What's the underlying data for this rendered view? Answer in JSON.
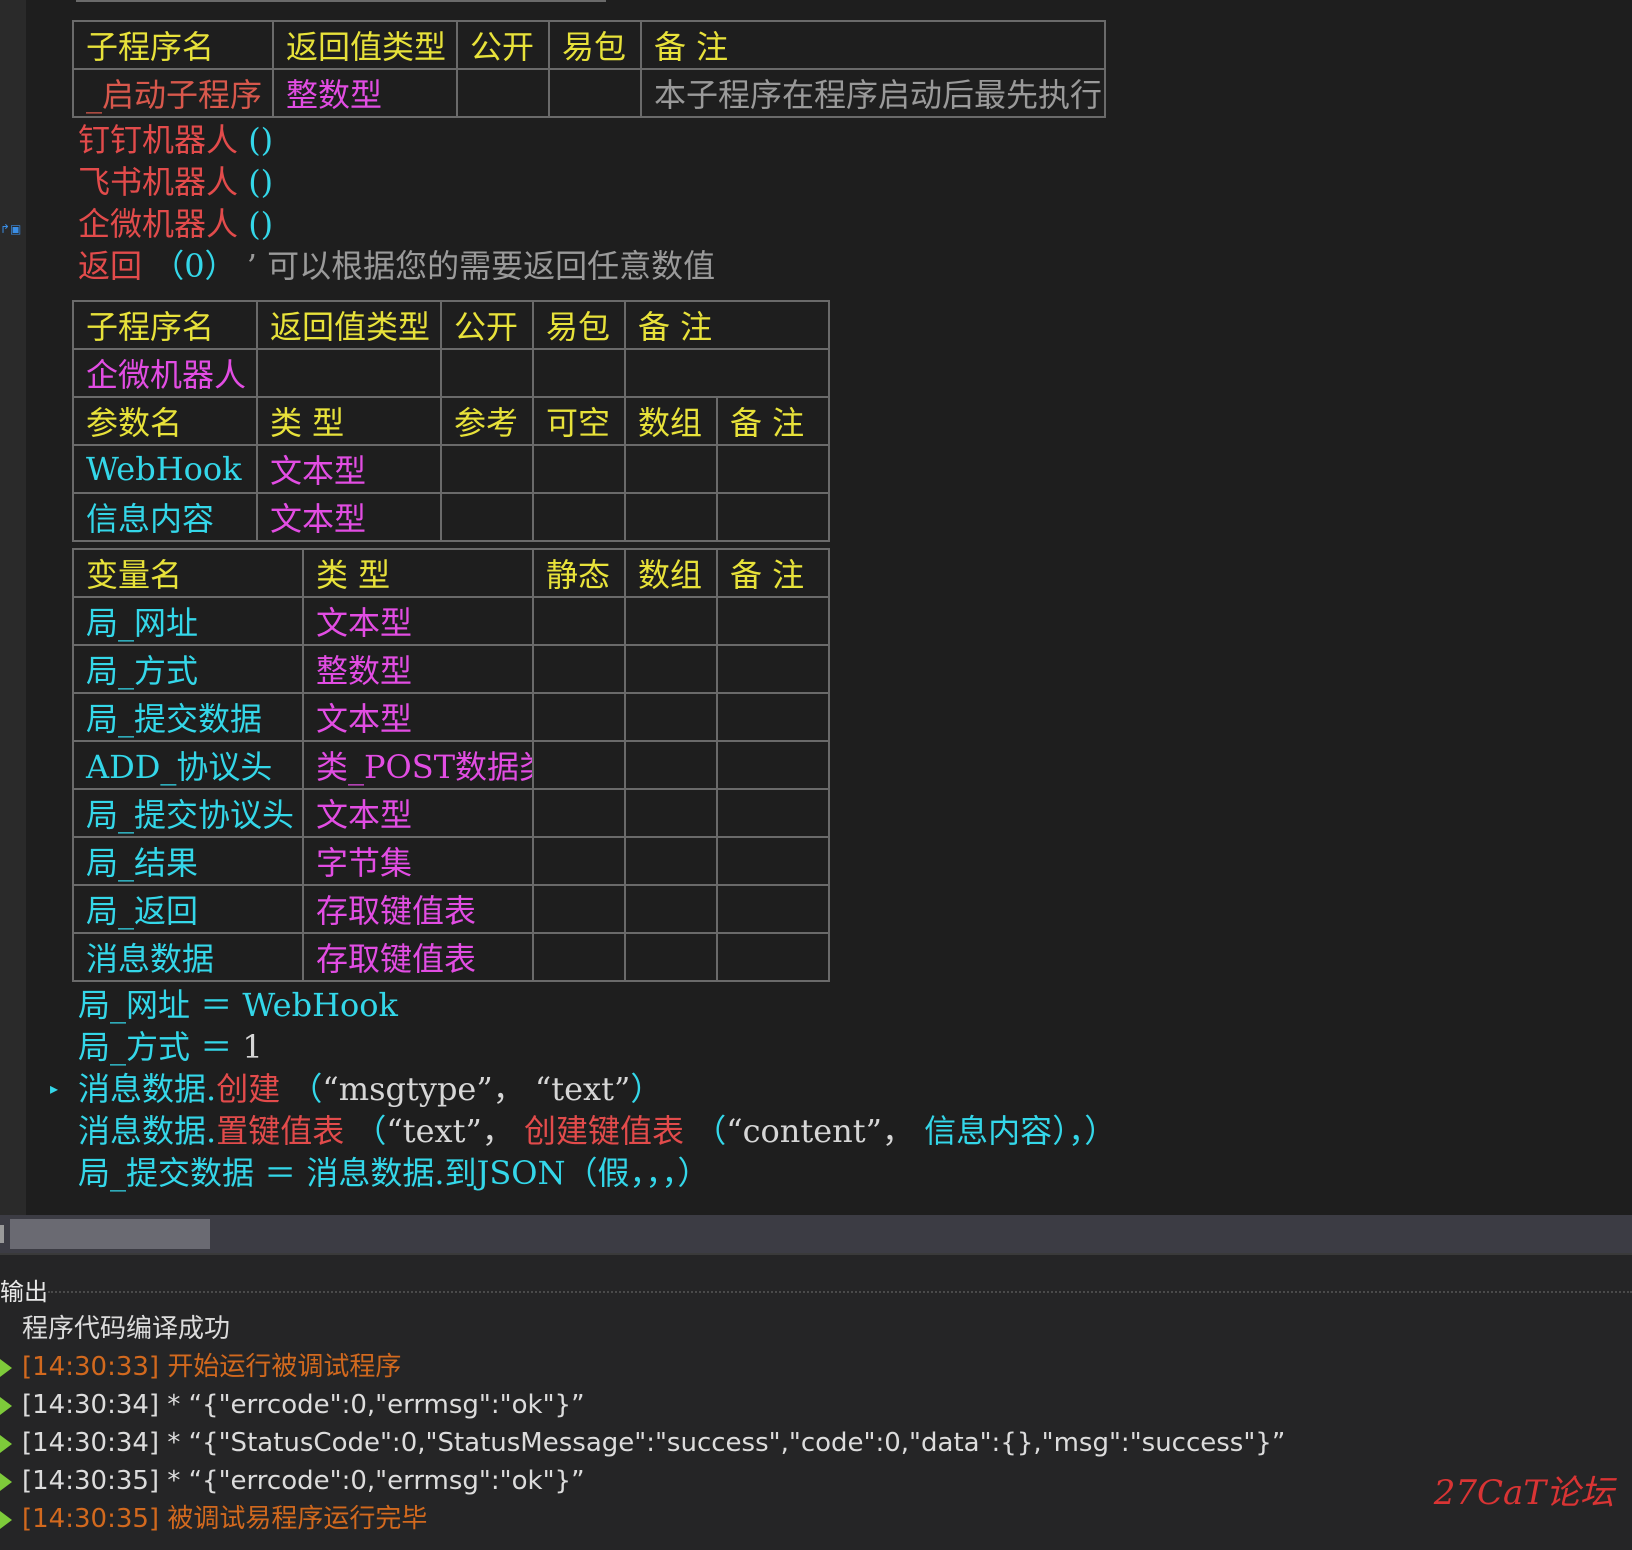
{
  "gutter": {
    "marker": "↱▣"
  },
  "table1": {
    "headers": [
      "子程序名",
      "返回值类型",
      "公开",
      "易包",
      "备 注"
    ],
    "row": {
      "name": "_启动子程序",
      "return_type": "整数型",
      "public": "",
      "package": "",
      "note": "本子程序在程序启动后最先执行"
    }
  },
  "code1": {
    "lines": [
      {
        "call": "钉钉机器人",
        "args": "()"
      },
      {
        "call": "飞书机器人",
        "args": "()"
      },
      {
        "call": "企微机器人",
        "args": "()"
      }
    ],
    "return_kw": "返回",
    "return_args": "（0）",
    "comment_mark": "’",
    "comment": "可以根据您的需要返回任意数值"
  },
  "table2": {
    "headers": [
      "子程序名",
      "返回值类型",
      "公开",
      "易包",
      "备 注"
    ],
    "name": "企微机器人",
    "param_headers": [
      "参数名",
      "类 型",
      "参考",
      "可空",
      "数组",
      "备 注"
    ],
    "params": [
      {
        "name": "WebHook",
        "type": "文本型"
      },
      {
        "name": "信息内容",
        "type": "文本型"
      }
    ]
  },
  "table3": {
    "headers": [
      "变量名",
      "类 型",
      "静态",
      "数组",
      "备 注"
    ],
    "vars": [
      {
        "name": "局_网址",
        "type": "文本型"
      },
      {
        "name": "局_方式",
        "type": "整数型"
      },
      {
        "name": "局_提交数据",
        "type": "文本型"
      },
      {
        "name": "ADD_协议头",
        "type": "类_POST数据类"
      },
      {
        "name": "局_提交协议头",
        "type": "文本型"
      },
      {
        "name": "局_结果",
        "type": "字节集"
      },
      {
        "name": "局_返回",
        "type": "存取键值表"
      },
      {
        "name": "消息数据",
        "type": "存取键值表"
      }
    ]
  },
  "code2": {
    "l1": {
      "var": "局_网址",
      "op": "＝",
      "val": "WebHook"
    },
    "l2": {
      "var": "局_方式",
      "op": "＝",
      "val": "1"
    },
    "l3": {
      "obj": "消息数据.",
      "method": "创建",
      "open": "（",
      "arg": "“msgtype”，  “text”",
      "close": "）"
    },
    "l4": {
      "obj": "消息数据.",
      "method": "置键值表",
      "open": "（",
      "arg1": "“text”，",
      "fn": "创建键值表",
      "fn_open": "（",
      "arg2": "“content”，",
      "arg3": "信息内容",
      "tail": "），）"
    },
    "l5_partial": "局_提交数据 ＝ 消息数据.到JSON（假，，，）"
  },
  "output": {
    "title": "输出",
    "lines": [
      {
        "text": "程序代码编译成功",
        "kind": "info"
      },
      {
        "text": "[14:30:33] 开始运行被调试程序",
        "kind": "event"
      },
      {
        "text": "[14:30:34] *   “{\"errcode\":0,\"errmsg\":\"ok\"}”",
        "kind": "info"
      },
      {
        "text": "[14:30:34] *   “{\"StatusCode\":0,\"StatusMessage\":\"success\",\"code\":0,\"data\":{},\"msg\":\"success\"}”",
        "kind": "info"
      },
      {
        "text": "[14:30:35] *   “{\"errcode\":0,\"errmsg\":\"ok\"}”",
        "kind": "info"
      },
      {
        "text": "[14:30:35] 被调试易程序运行完毕",
        "kind": "event"
      }
    ]
  },
  "watermark": "27CaT论坛"
}
